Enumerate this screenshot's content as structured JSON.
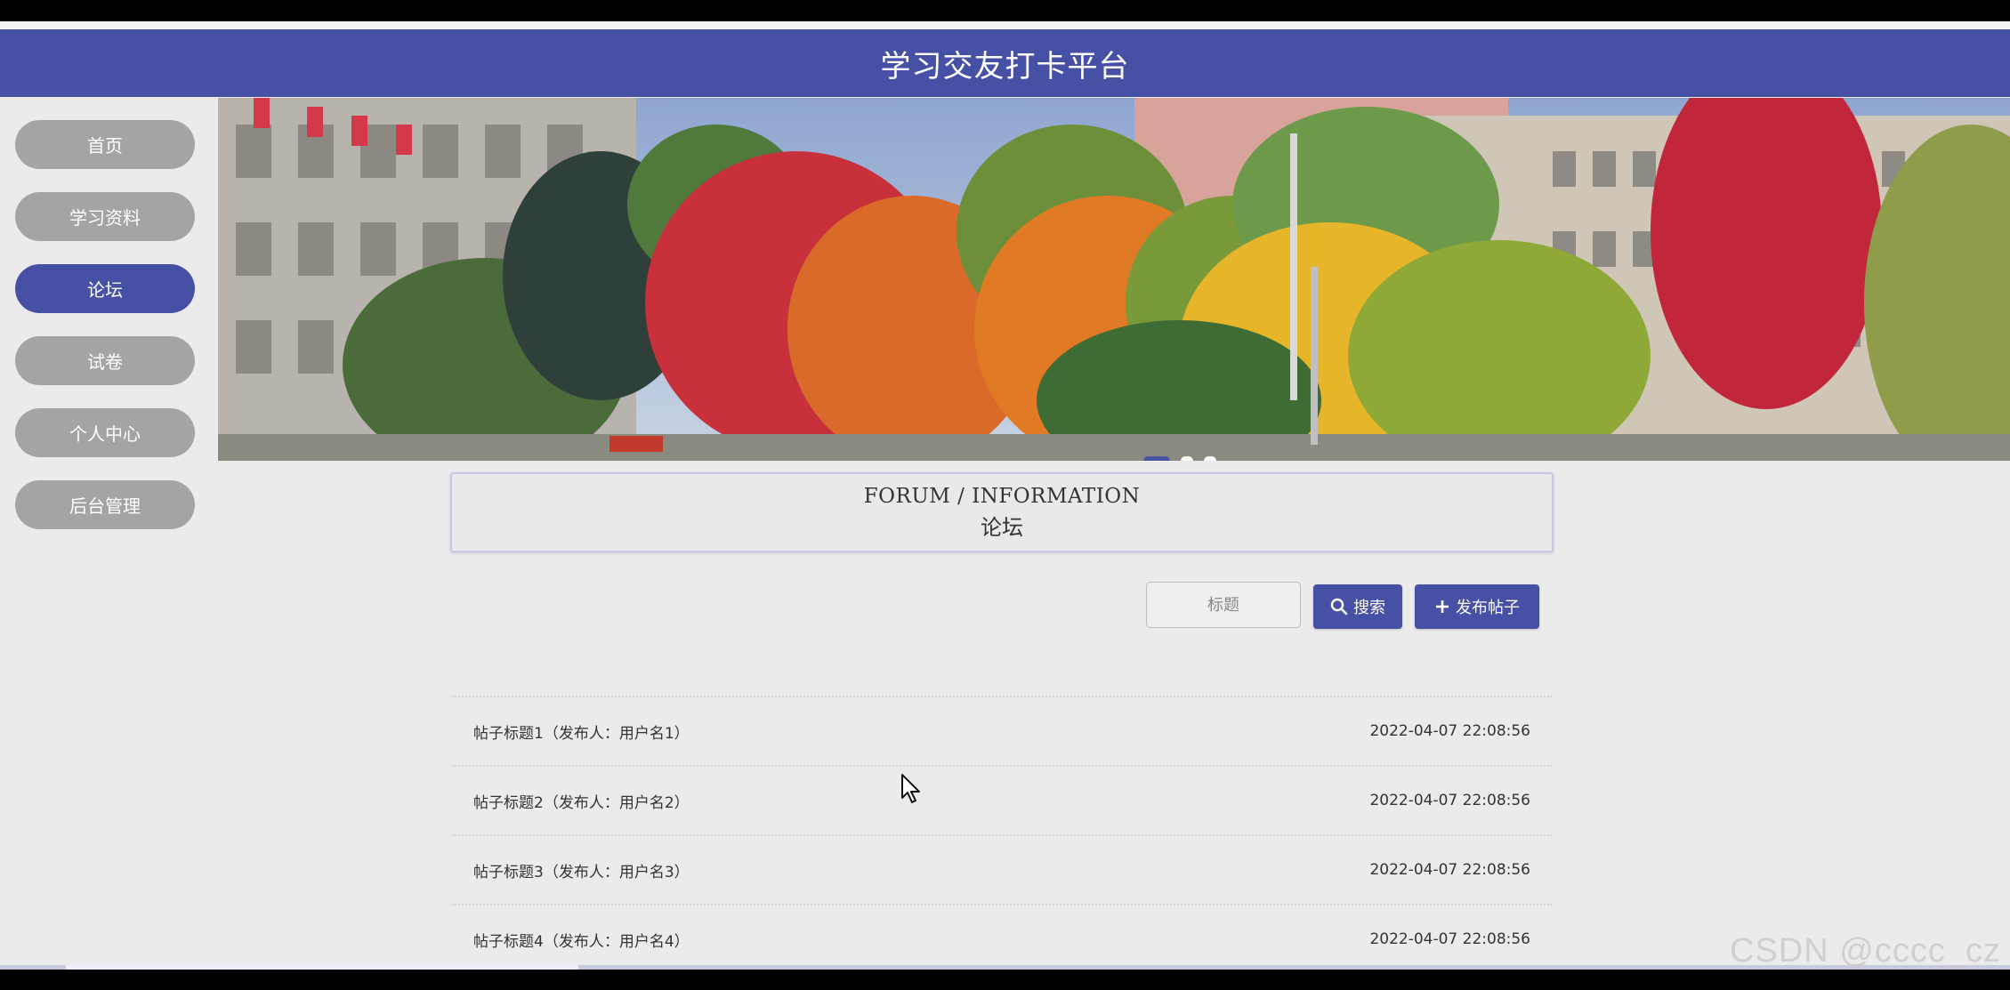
{
  "app": {
    "title": "学习交友打卡平台"
  },
  "sidebar": {
    "items": [
      {
        "label": "首页",
        "active": false
      },
      {
        "label": "学习资料",
        "active": false
      },
      {
        "label": "论坛",
        "active": true
      },
      {
        "label": "试卷",
        "active": false
      },
      {
        "label": "个人中心",
        "active": false
      },
      {
        "label": "后台管理",
        "active": false
      }
    ]
  },
  "section": {
    "title_en": "FORUM / INFORMATION",
    "title_cn": "论坛"
  },
  "search": {
    "placeholder": "标题",
    "button_label": "搜索",
    "post_button_label": "发布帖子"
  },
  "posts": [
    {
      "title": "帖子标题1（发布人：用户名1）",
      "time": "2022-04-07 22:08:56"
    },
    {
      "title": "帖子标题2（发布人：用户名2）",
      "time": "2022-04-07 22:08:56"
    },
    {
      "title": "帖子标题3（发布人：用户名3）",
      "time": "2022-04-07 22:08:56"
    },
    {
      "title": "帖子标题4（发布人：用户名4）",
      "time": "2022-04-07 22:08:56"
    }
  ],
  "watermark": "CSDN @cccc_cz",
  "colors": {
    "primary": "#4651a6",
    "nav_inactive": "#a4a4a4",
    "background": "#ebebeb"
  },
  "icons": {
    "search": "search-icon",
    "post": "plus-icon",
    "cursor": "mouse-pointer-icon"
  }
}
